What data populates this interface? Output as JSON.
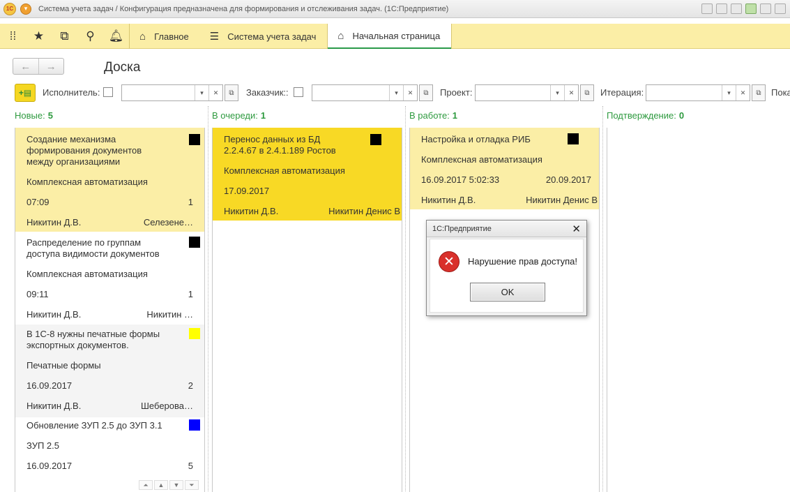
{
  "window": {
    "logo": "1С",
    "title": "Система учета задач / Конфигурация предназначена для формирования и отслеживания задач. (1С:Предприятие)"
  },
  "toppanel": {
    "tabs": [
      {
        "label": "Главное",
        "icon": "home-icon"
      },
      {
        "label": "Система учета задач",
        "icon": "list-icon"
      },
      {
        "label": "Начальная страница",
        "icon": "home-icon"
      }
    ]
  },
  "page": {
    "title": "Доска"
  },
  "filters": {
    "executor_label": "Исполнитель:",
    "customer_label": "Заказчик::",
    "project_label": "Проект:",
    "iteration_label": "Итерация:",
    "more_label": "Пока"
  },
  "columns": [
    {
      "title": "Новые:",
      "count": "5"
    },
    {
      "title": "В очереди:",
      "count": "1"
    },
    {
      "title": "В работе:",
      "count": "1"
    },
    {
      "title": "Подтверждение:",
      "count": "0"
    }
  ],
  "cards": {
    "new": [
      {
        "title": [
          "Создание механизма",
          "формирования документов",
          "между организациями"
        ],
        "project": "Комплексная автоматизация",
        "time": "07:09",
        "num": "1",
        "author": "Никитин Д.В.",
        "executor": "Селезене…",
        "color": "#000000"
      },
      {
        "title": [
          "Распределение по группам",
          "доступа видимости документов"
        ],
        "project": "Комплексная автоматизация",
        "time": "09:11",
        "num": "1",
        "author": "Никитин Д.В.",
        "executor": "Никитин …",
        "color": "#000000"
      },
      {
        "title": [
          "В 1С-8 нужны печатные формы",
          "экспортных документов."
        ],
        "project": "Печатные формы",
        "time": "16.09.2017",
        "num": "2",
        "author": "Никитин Д.В.",
        "executor": "Шеберова…",
        "color": "#ffff00"
      },
      {
        "title": [
          "Обновление ЗУП 2.5 до ЗУП 3.1"
        ],
        "project": "ЗУП 2.5",
        "time": "16.09.2017",
        "num": "5",
        "color": "#0000ff"
      }
    ],
    "queue": [
      {
        "title": [
          "Перенос данных из БД",
          "2.2.4.67 в 2.4.1.189 Ростов"
        ],
        "project": "Комплексная автоматизация",
        "time": "17.09.2017",
        "author": "Никитин Д.В.",
        "executor": "Никитин Денис В",
        "color": "#000000"
      }
    ],
    "work": [
      {
        "title": [
          "Настройка и отладка РИБ"
        ],
        "project": "Комплексная автоматизация",
        "time": "16.09.2017 5:02:33",
        "deadline": "20.09.2017",
        "author": "Никитин Д.В.",
        "executor": "Никитин Денис В",
        "color": "#000000"
      }
    ]
  },
  "dialog": {
    "title": "1С:Предприятие",
    "message": "Нарушение прав доступа!",
    "ok_label": "OK"
  }
}
